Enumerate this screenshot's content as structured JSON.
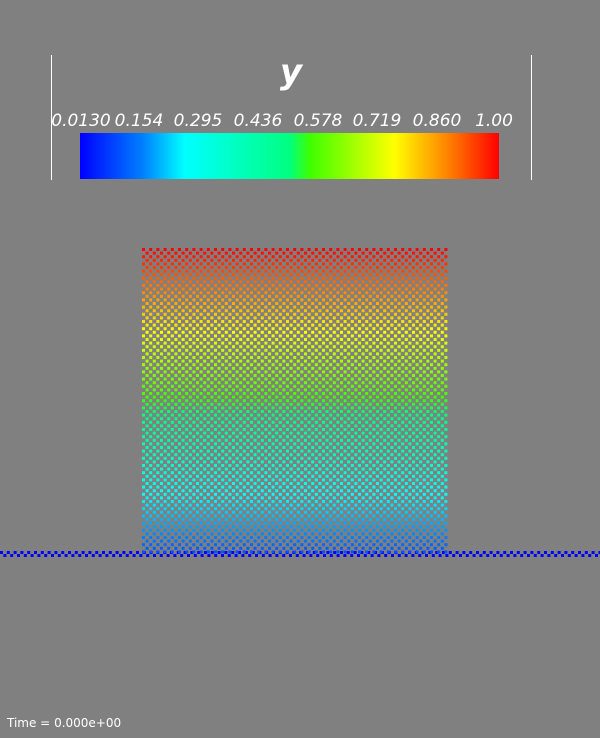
{
  "colorbar": {
    "title": "y",
    "tick_labels": [
      "0.0130",
      "0.154",
      "0.295",
      "0.436",
      "0.578",
      "0.719",
      "0.860",
      "1.00"
    ],
    "range": [
      0.013,
      1.0
    ],
    "colormap": "rainbow (blue-cyan-green-yellow-red)",
    "colors": [
      "#0000ff",
      "#00ffff",
      "#00ff80",
      "#ffff00",
      "#ff0000"
    ]
  },
  "scene": {
    "background": "#808080",
    "block_particles": "checkerboard grid colored by y",
    "ground_particles_color": "#0000ff"
  },
  "time": {
    "label": "Time = ",
    "value": "0.000e+00"
  }
}
